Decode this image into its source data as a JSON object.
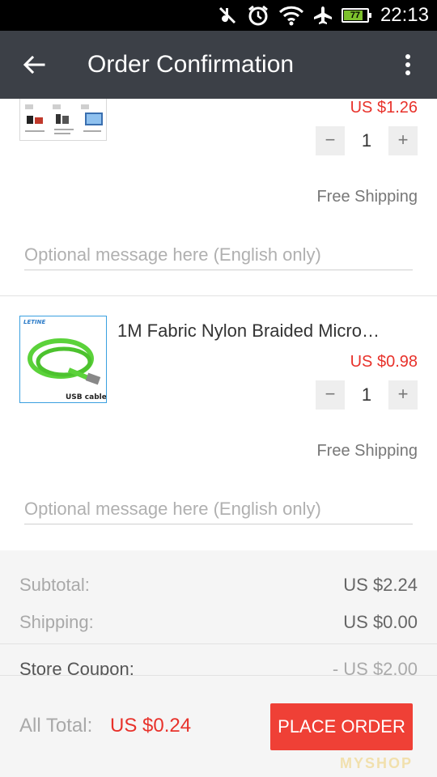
{
  "status_bar": {
    "time": "22:13",
    "battery_level": "77",
    "icons": [
      "mute-icon",
      "alarm-icon",
      "wifi-icon",
      "airplane-icon",
      "battery-icon"
    ]
  },
  "app_bar": {
    "title": "Order Confirmation",
    "back_icon": "arrow-left-icon",
    "menu_icon": "more-vertical-icon"
  },
  "items": [
    {
      "name": "",
      "price": "US $1.26",
      "quantity": "1",
      "decrement": "−",
      "increment": "+",
      "shipping": "Free Shipping",
      "message_placeholder": "Optional message here (English only)"
    },
    {
      "name": "1M Fabric Nylon Braided Micro…",
      "thumb_caption": "USB cable",
      "thumb_brand": "LETINE",
      "price": "US $0.98",
      "quantity": "1",
      "decrement": "−",
      "increment": "+",
      "shipping": "Free Shipping",
      "message_placeholder": "Optional message here (English only)"
    }
  ],
  "summary": {
    "subtotal_label": "Subtotal:",
    "subtotal_value": "US $2.24",
    "shipping_label": "Shipping:",
    "shipping_value": "US $0.00",
    "coupon_label": "Store Coupon:",
    "coupon_value": "- US $2.00"
  },
  "footer": {
    "total_label": "All Total:",
    "total_value": "US $0.24",
    "place_order": "PLACE ORDER",
    "watermark": "MYSHOP"
  },
  "colors": {
    "app_bar": "#3c4047",
    "price": "#e8322b",
    "button": "#ef4036"
  }
}
